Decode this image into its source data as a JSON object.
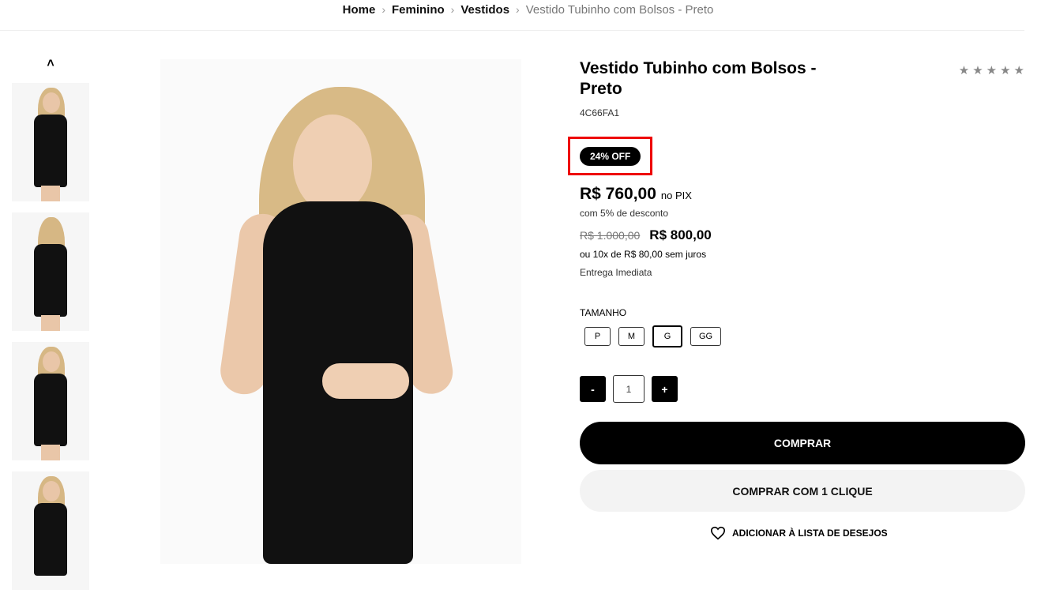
{
  "breadcrumb": {
    "home": "Home",
    "cat1": "Feminino",
    "cat2": "Vestidos",
    "current": "Vestido Tubinho com Bolsos - Preto",
    "separator": "›"
  },
  "gallery": {
    "up_icon": "˄",
    "thumbs": [
      "front",
      "back",
      "front",
      "side"
    ]
  },
  "product": {
    "title": "Vestido Tubinho com Bolsos - Preto",
    "sku": "4C66FA1",
    "rating_stars": [
      "★",
      "★",
      "★",
      "★",
      "★"
    ],
    "badge": "24% OFF",
    "price_pix": "R$ 760,00",
    "pix_label": "no PIX",
    "pix_discount": "com 5% de desconto",
    "old_price": "R$ 1.000,00",
    "price": "R$ 800,00",
    "installments": "ou 10x de R$ 80,00 sem juros",
    "delivery": "Entrega Imediata"
  },
  "sizes": {
    "label": "TAMANHO",
    "options": [
      "P",
      "M",
      "G",
      "GG"
    ],
    "selected": "G"
  },
  "quantity": {
    "minus": "-",
    "value": "1",
    "plus": "+"
  },
  "actions": {
    "buy": "COMPRAR",
    "buy_one_click": "COMPRAR COM 1 CLIQUE",
    "wishlist": "ADICIONAR À LISTA DE DESEJOS"
  },
  "colors": {
    "accent": "#000000",
    "highlight_box": "#ee0000",
    "secondary_button": "#f3f3f3"
  }
}
